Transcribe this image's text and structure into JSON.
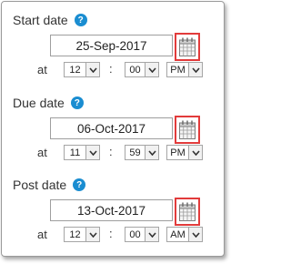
{
  "sections": [
    {
      "label": "Start date",
      "date": "25-Sep-2017",
      "at_label": "at",
      "hour": "12",
      "colon": ":",
      "minute": "00",
      "ampm": "PM"
    },
    {
      "label": "Due date",
      "date": "06-Oct-2017",
      "at_label": "at",
      "hour": "11",
      "colon": ":",
      "minute": "59",
      "ampm": "PM"
    },
    {
      "label": "Post date",
      "date": "13-Oct-2017",
      "at_label": "at",
      "hour": "12",
      "colon": ":",
      "minute": "00",
      "ampm": "AM"
    }
  ],
  "help_glyph": "?",
  "colors": {
    "help_icon": "#1a8dd1",
    "calendar_highlight": "#e23b3b"
  },
  "icons": {
    "help": "question-circle-icon",
    "calendar": "calendar-icon",
    "dropdown": "chevron-down-icon"
  }
}
